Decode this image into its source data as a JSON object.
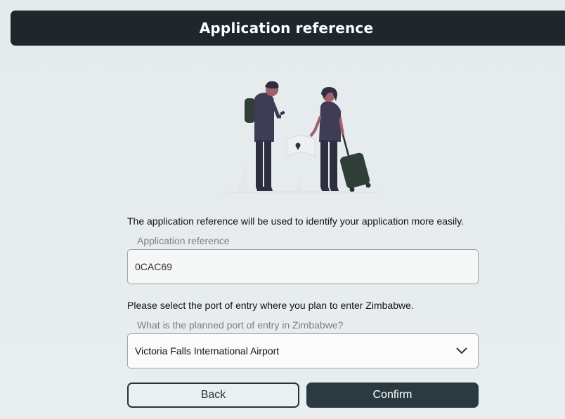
{
  "header": {
    "title": "Application reference"
  },
  "intro_text": "The application reference will be used to identify your application more easily.",
  "reference_field": {
    "label": "Application reference",
    "value": "0CAC69"
  },
  "port_text": "Please select the port of entry where you plan to enter Zimbabwe.",
  "port_field": {
    "label": "What is the planned port of entry in Zimbabwe?",
    "selected": "Victoria Falls International Airport"
  },
  "buttons": {
    "back": "Back",
    "confirm": "Confirm"
  },
  "colors": {
    "header_bg": "#1f272d",
    "confirm_bg": "#2b3a40",
    "accent_figure": "#3f3d56"
  }
}
